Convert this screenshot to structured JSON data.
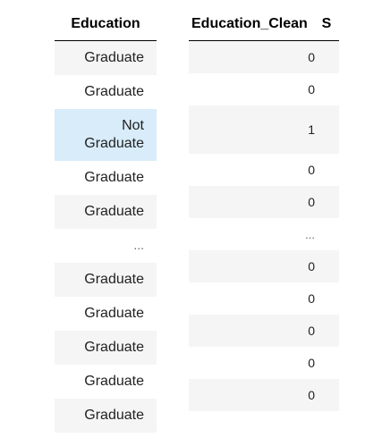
{
  "left_table": {
    "header": "Education",
    "rows": [
      {
        "value": "Graduate"
      },
      {
        "value": "Graduate"
      },
      {
        "value": "Not\nGraduate"
      },
      {
        "value": "Graduate"
      },
      {
        "value": "Graduate"
      },
      {
        "value": "..."
      },
      {
        "value": "Graduate"
      },
      {
        "value": "Graduate"
      },
      {
        "value": "Graduate"
      },
      {
        "value": "Graduate"
      },
      {
        "value": "Graduate"
      }
    ]
  },
  "right_table": {
    "headers": [
      "Education_Clean",
      "S"
    ],
    "rows": [
      {
        "value": "0"
      },
      {
        "value": "0"
      },
      {
        "value": "1"
      },
      {
        "value": "0"
      },
      {
        "value": "0"
      },
      {
        "value": "..."
      },
      {
        "value": "0"
      },
      {
        "value": "0"
      },
      {
        "value": "0"
      },
      {
        "value": "0"
      },
      {
        "value": "0"
      }
    ]
  }
}
